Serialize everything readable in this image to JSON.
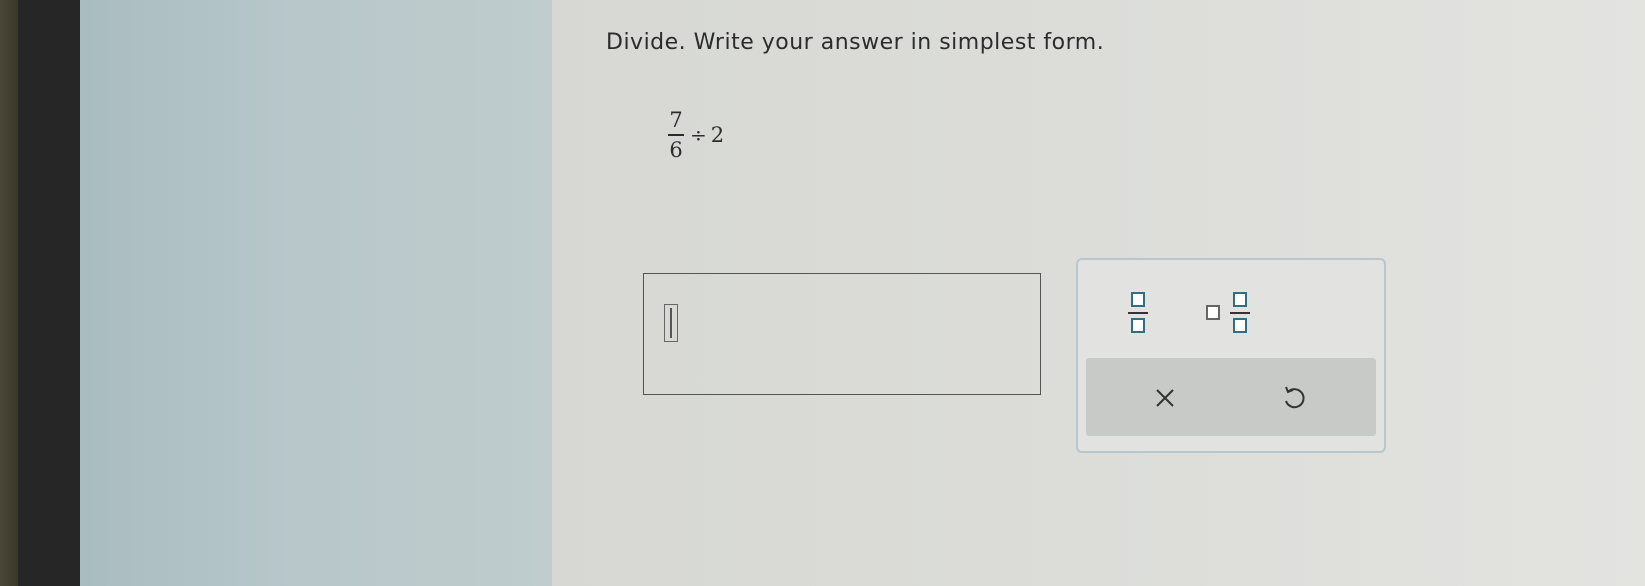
{
  "question": {
    "instruction": "Divide. Write your answer in simplest form.",
    "expression": {
      "numerator": "7",
      "denominator": "6",
      "operator": "÷",
      "divisor": "2"
    }
  },
  "answer": {
    "value": ""
  },
  "palette": {
    "tools": [
      {
        "icon": "fraction-template-icon"
      },
      {
        "icon": "mixed-number-template-icon"
      }
    ],
    "actions": [
      {
        "icon": "close-icon"
      },
      {
        "icon": "undo-icon"
      }
    ]
  },
  "colors": {
    "accent": "#2f6f86",
    "palette_border": "#b8c7cf",
    "action_bar": "#c8cac8"
  }
}
